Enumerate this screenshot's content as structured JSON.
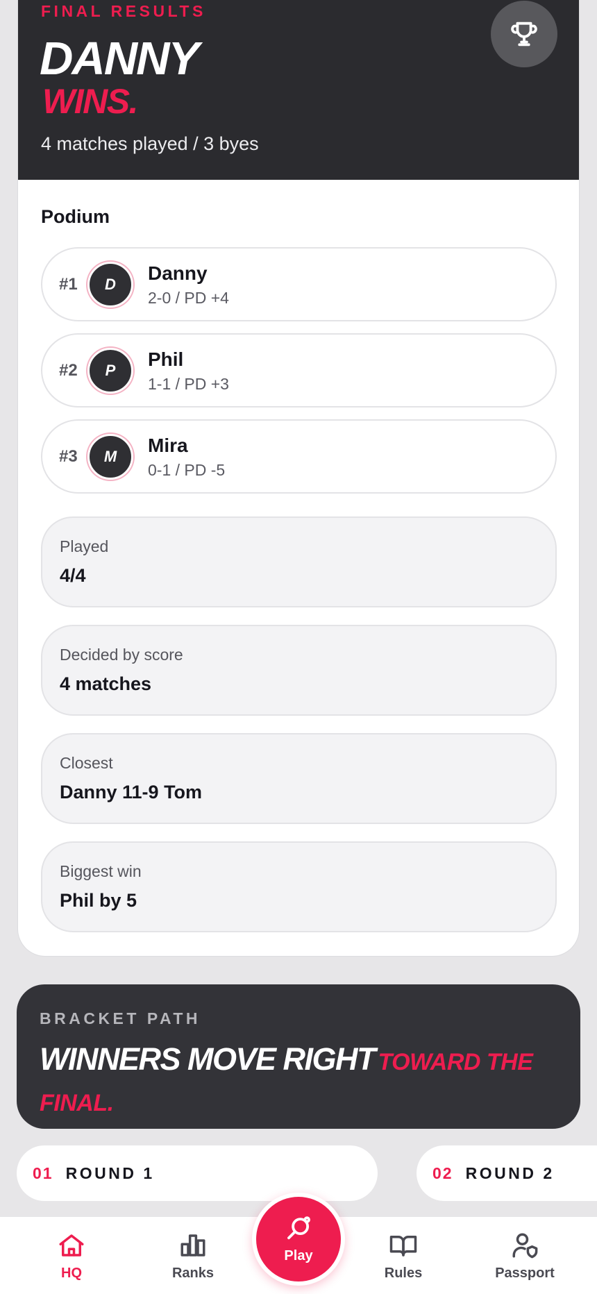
{
  "colors": {
    "accent": "#ee1d4f",
    "hero_bg": "#2b2b2f",
    "bracket_bg": "#333338",
    "page_bg": "#e7e6e8"
  },
  "hero": {
    "kicker": "FINAL RESULTS",
    "title": "DANNY",
    "accent": "WINS.",
    "subtitle": "4 matches played / 3 byes",
    "trophy_icon": "trophy-icon"
  },
  "podium": {
    "title": "Podium",
    "rows": [
      {
        "rank": "#1",
        "initial": "D",
        "name": "Danny",
        "stat": "2-0 / PD +4"
      },
      {
        "rank": "#2",
        "initial": "P",
        "name": "Phil",
        "stat": "1-1 / PD +3"
      },
      {
        "rank": "#3",
        "initial": "M",
        "name": "Mira",
        "stat": "0-1 / PD -5"
      }
    ]
  },
  "stats": [
    {
      "label": "Played",
      "value": "4/4"
    },
    {
      "label": "Decided by score",
      "value": "4 matches"
    },
    {
      "label": "Closest",
      "value": "Danny 11-9 Tom"
    },
    {
      "label": "Biggest win",
      "value": "Phil by 5"
    }
  ],
  "bracket": {
    "kicker": "BRACKET PATH",
    "title_main": "WINNERS MOVE RIGHT",
    "title_accent": "TOWARD THE FINAL."
  },
  "rounds": [
    {
      "num": "01",
      "label": "ROUND 1"
    },
    {
      "num": "02",
      "label": "ROUND 2"
    }
  ],
  "nav": {
    "items": [
      {
        "label": "HQ",
        "icon": "home-icon",
        "active": true
      },
      {
        "label": "Ranks",
        "icon": "bar-chart-icon",
        "active": false
      },
      {
        "label": "Play",
        "icon": "ping-pong-paddle-icon",
        "active": false
      },
      {
        "label": "Rules",
        "icon": "book-icon",
        "active": false
      },
      {
        "label": "Passport",
        "icon": "user-shield-icon",
        "active": false
      }
    ]
  }
}
